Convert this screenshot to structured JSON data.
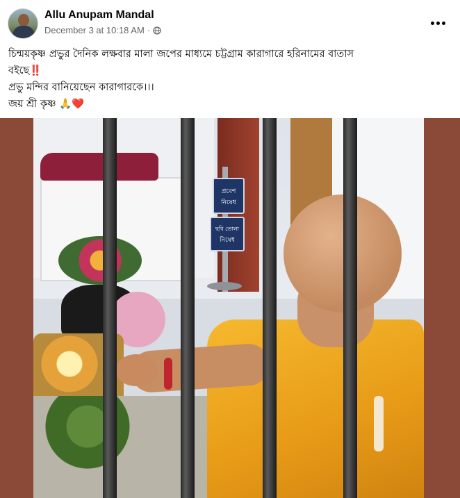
{
  "post": {
    "author_name": "Allu Anupam Mandal",
    "timestamp": "December 3 at 10:18 AM",
    "meta_separator": "·",
    "audience_icon": "globe-icon",
    "more_icon": "more-horizontal-icon",
    "caption": {
      "line1": "চিন্ময়কৃষ্ণ প্রভুর দৈনিক লক্ষবার মালা জপের মাধ্যমে চট্টগ্রাম কারাগারে হরিনামের বাতাস",
      "line2": "বইছে",
      "line2_emoji": "‼️",
      "line3": "প্রভু মন্দির বানিয়েছেন কারাগারকে।।।",
      "line4": "জয় শ্রী কৃষ্ণ",
      "line4_emoji_pray": "🙏",
      "line4_emoji_heart": "❤️"
    },
    "photo": {
      "sign_top": "প্রবেশ নিষেধ",
      "sign_bottom": "ছবি তোলা নিষেধ"
    }
  },
  "colors": {
    "author": "#050505",
    "meta": "#65676b",
    "photo_border": "#8a4a37",
    "robe": "#f0a522"
  }
}
